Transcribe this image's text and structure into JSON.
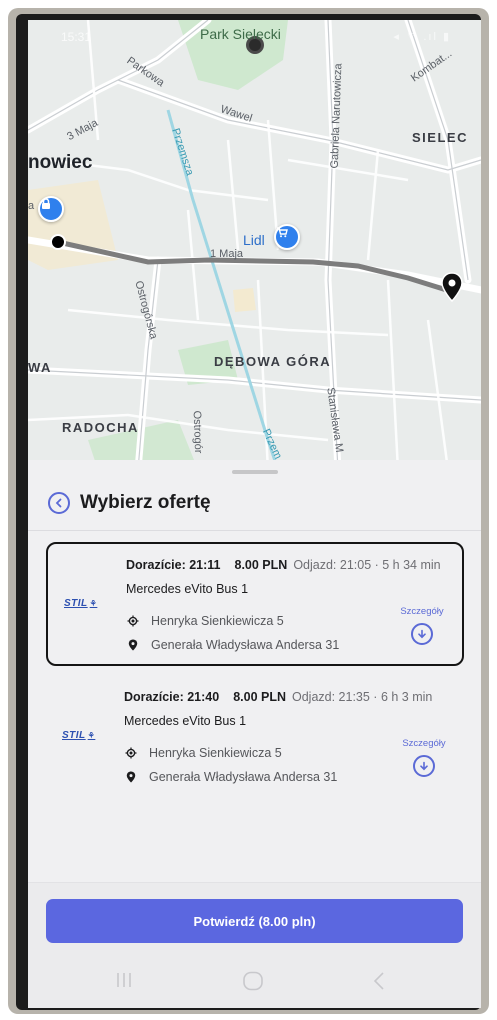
{
  "status_bar": {
    "time": "15:31",
    "icons": "◂ ⌔ .ıl ▮"
  },
  "map": {
    "labels": {
      "park": "Park Sielecki",
      "parkowa": "Parkowa",
      "kombatantow": "Kombat...",
      "trzecia_maja": "3 Maja",
      "wawel": "Wawel",
      "przemsza": "Przemsza",
      "narutowicza": "Gabriela Narutowicza",
      "sielec": "SIELEC",
      "sosnowiec": "nowiec",
      "lidl": "Lidl",
      "pierwszy_maja": "1 Maja",
      "ostrogorska": "Ostrogórska",
      "debowa_gora": "DĘBOWA GÓRA",
      "wa": "WA",
      "stanislawa": "Stanisława M",
      "radocha": "RADOCHA",
      "ostrogor2": "Ostrogór",
      "przem2": "Przem",
      "a_label": "a"
    }
  },
  "sheet": {
    "title": "Wybierz ofertę",
    "offers": [
      {
        "deadline": "Dorazície: 21:11",
        "price": "8.00 PLN",
        "departure": "Odjazd: 21:05 · 5 h 34 min",
        "vehicle": "Mercedes eVito Bus 1",
        "from": "Henryka Sienkiewicza 5",
        "to": "Generała Władysława Andersa 31",
        "details_label": "Szczegóły",
        "logo": "STIL"
      },
      {
        "deadline": "Dorazície: 21:40",
        "price": "8.00 PLN",
        "departure": "Odjazd: 21:35 · 6 h 3 min",
        "vehicle": "Mercedes eVito Bus 1",
        "from": "Henryka Sienkiewicza 5",
        "to": "Generała Władysława Andersa 31",
        "details_label": "Szczegóły",
        "logo": "STIL"
      }
    ],
    "confirm_label": "Potwierdź (8.00 pln)"
  },
  "colors": {
    "accent": "#5b67e0",
    "map_bg": "#e9eceb",
    "route": "#808080",
    "pin_blue": "#2f80ed"
  }
}
